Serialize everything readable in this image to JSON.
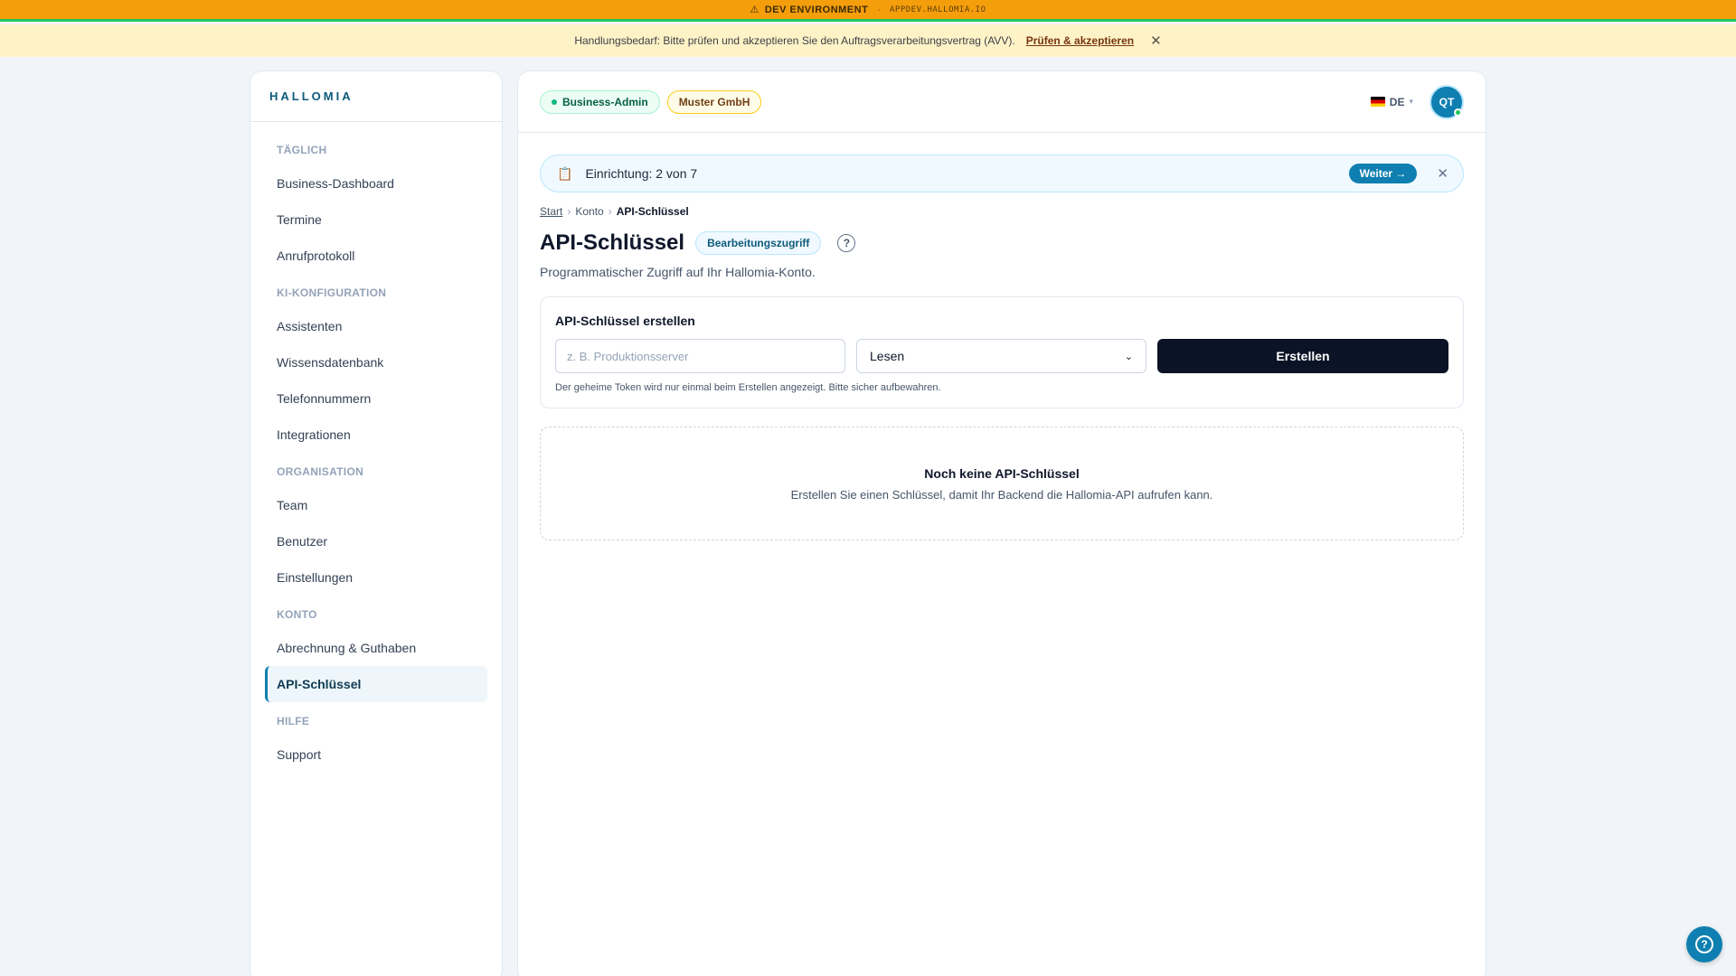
{
  "dev_banner": {
    "label": "DEV ENVIRONMENT",
    "separator": "·",
    "domain": "APPDEV.HALLOMIA.IO",
    "icon": "warning-icon"
  },
  "notice": {
    "text": "Handlungsbedarf: Bitte prüfen und akzeptieren Sie den Auftragsverarbeitungsvertrag (AVV).",
    "link": "Prüfen & akzeptieren",
    "close_icon": "close-icon"
  },
  "sidebar": {
    "brand": "HALLOMIA",
    "sections": [
      {
        "title": "TÄGLICH",
        "items": [
          "Business-Dashboard",
          "Termine",
          "Anrufprotokoll"
        ]
      },
      {
        "title": "KI-KONFIGURATION",
        "items": [
          "Assistenten",
          "Wissensdatenbank",
          "Telefonnummern",
          "Integrationen"
        ]
      },
      {
        "title": "ORGANISATION",
        "items": [
          "Team",
          "Benutzer",
          "Einstellungen"
        ]
      },
      {
        "title": "KONTO",
        "items": [
          "Abrechnung & Guthaben",
          "API-Schlüssel"
        ]
      },
      {
        "title": "HILFE",
        "items": [
          "Support"
        ]
      }
    ],
    "active_item": "API-Schlüssel"
  },
  "header": {
    "role_badge": "Business-Admin",
    "org_badge": "Muster GmbH",
    "language": "DE",
    "avatar_initials": "QT"
  },
  "setup": {
    "icon": "clipboard-icon",
    "text": "Einrichtung: 2 von 7",
    "next_label": "Weiter →"
  },
  "breadcrumb": {
    "start": "Start",
    "konto": "Konto",
    "current": "API-Schlüssel",
    "sep": "›"
  },
  "page": {
    "title": "API-Schlüssel",
    "access_badge": "Bearbeitungszugriff",
    "subtitle": "Programmatischer Zugriff auf Ihr Hallomia-Konto."
  },
  "create_form": {
    "heading": "API-Schlüssel erstellen",
    "name_placeholder": "z. B. Produktionsserver",
    "name_value": "",
    "scope_selected": "Lesen",
    "submit_label": "Erstellen",
    "hint": "Der geheime Token wird nur einmal beim Erstellen angezeigt. Bitte sicher aufbewahren."
  },
  "empty_state": {
    "title": "Noch keine API-Schlüssel",
    "text": "Erstellen Sie einen Schlüssel, damit Ihr Backend die Hallomia-API aufrufen kann."
  },
  "colors": {
    "accent": "#0e7fb0",
    "dev_banner": "#f59e0b",
    "notice": "#fef3c7",
    "primary_button": "#0b1426"
  }
}
